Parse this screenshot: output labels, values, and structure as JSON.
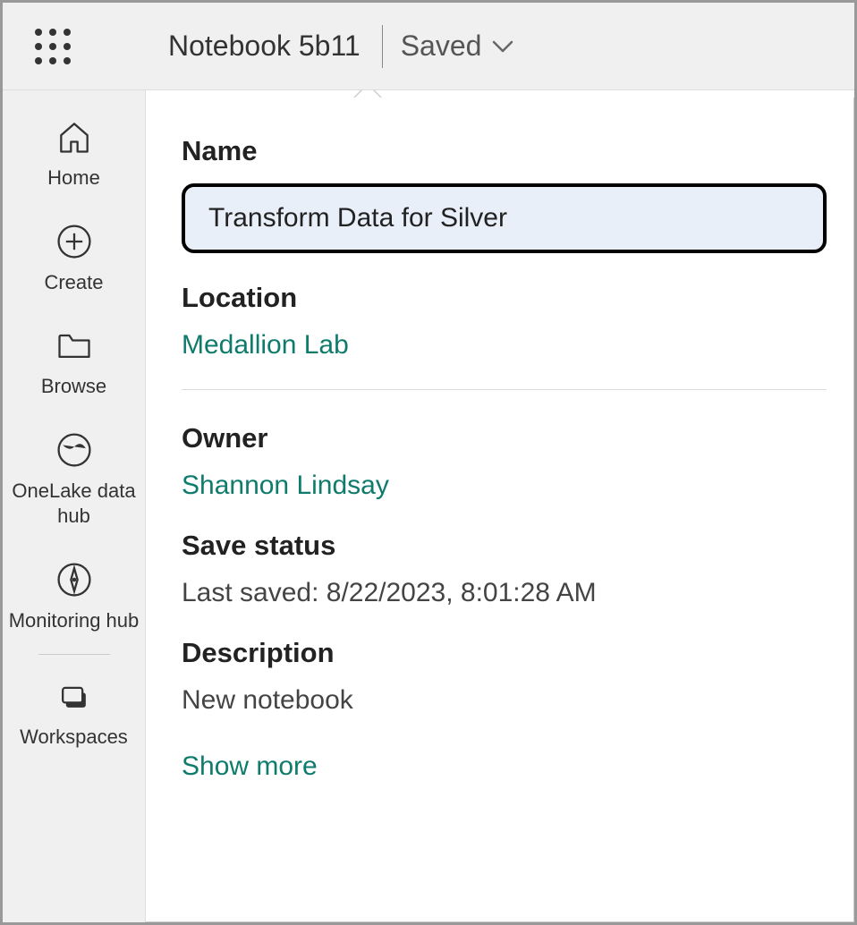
{
  "header": {
    "notebook_title": "Notebook 5b11",
    "saved_label": "Saved"
  },
  "sidebar": {
    "items": [
      {
        "label": "Home"
      },
      {
        "label": "Create"
      },
      {
        "label": "Browse"
      },
      {
        "label": "OneLake data hub"
      },
      {
        "label": "Monitoring hub"
      },
      {
        "label": "Workspaces"
      }
    ]
  },
  "panel": {
    "name_label": "Name",
    "name_value": "Transform Data for Silver",
    "location_label": "Location",
    "location_value": "Medallion Lab",
    "owner_label": "Owner",
    "owner_value": "Shannon Lindsay",
    "save_status_label": "Save status",
    "save_status_value": "Last saved: 8/22/2023, 8:01:28 AM",
    "description_label": "Description",
    "description_value": "New notebook",
    "show_more_label": "Show more"
  }
}
